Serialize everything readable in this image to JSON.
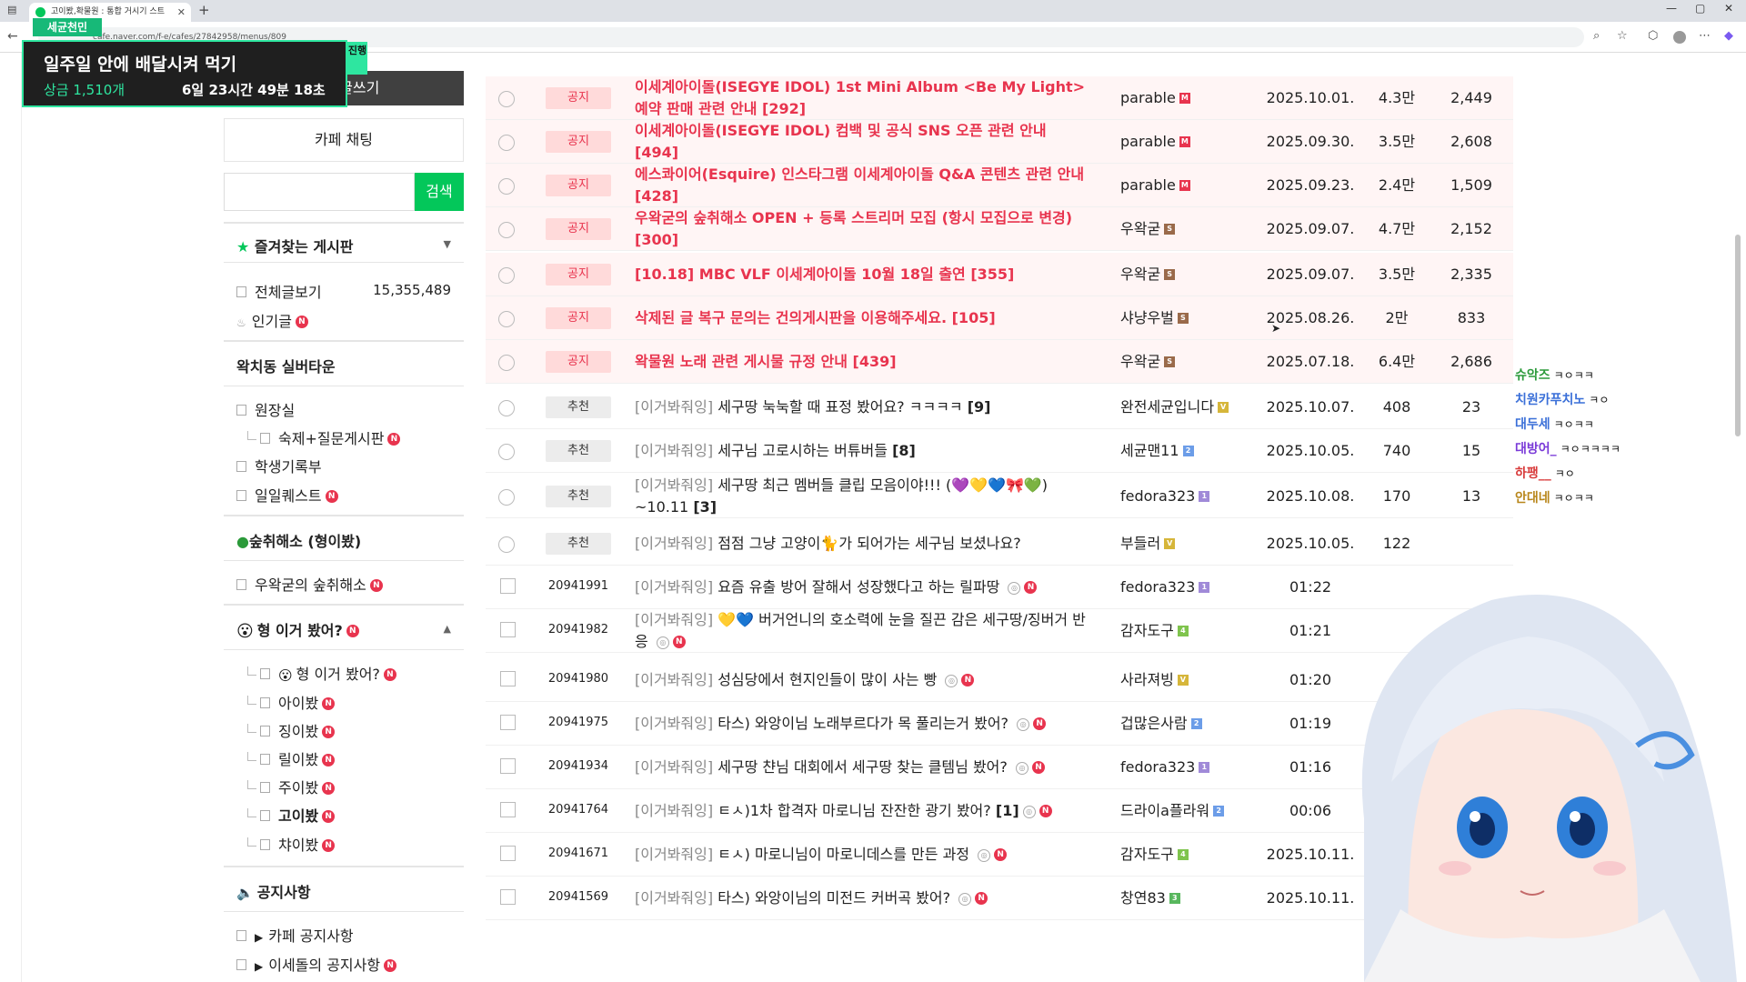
{
  "browser": {
    "tab_title": "고이봤,확물원 : 통합 거시기 스트",
    "url": "cafe.naver.com/f-e/cafes/27842958/menus/809",
    "new_tab": "+",
    "win_min": "—",
    "win_max": "▢",
    "win_close": "✕"
  },
  "overlay": {
    "badge": "세균천민",
    "title": "일주일 안에 배달시켜 먹기",
    "prize": "상금 1,510개",
    "time_left": "6일 23시간 49분 18초",
    "status": "진행"
  },
  "sidebar": {
    "write_label": "카페 글쓰기",
    "chat_label": "카페 채팅",
    "search_placeholder": "",
    "search_button": "검색",
    "favorites": {
      "title": "즐겨찾는 게시판",
      "items": [
        {
          "label": "전체글보기",
          "count": "15,355,489"
        },
        {
          "label": "인기글",
          "new": "N"
        }
      ]
    },
    "town": {
      "title": "왁치동 실버타운",
      "items": [
        {
          "label": "원장실"
        },
        {
          "label": "숙제+질문게시판",
          "new": "N"
        },
        {
          "label": "학생기록부"
        },
        {
          "label": "일일퀘스트",
          "new": "N"
        }
      ]
    },
    "rest": {
      "title": "숲취해소 (형이봤)",
      "items": [
        {
          "label": "우왁굳의 숲취해소",
          "new": "N"
        }
      ]
    },
    "hyung": {
      "title": "형 이거 봤어?",
      "new": "N",
      "items": [
        {
          "label": "형 이거 봤어?",
          "new": "N"
        },
        {
          "label": "아이봤",
          "new": "N"
        },
        {
          "label": "징이봤",
          "new": "N"
        },
        {
          "label": "릴이봤",
          "new": "N"
        },
        {
          "label": "주이봤",
          "new": "N"
        },
        {
          "label": "고이봤",
          "new": "N"
        },
        {
          "label": "챠이봤",
          "new": "N"
        }
      ]
    },
    "notice": {
      "title": "공지사항",
      "items": [
        {
          "label": "카페 공지사항"
        },
        {
          "label": "이세돌의 공지사항",
          "new": "N"
        }
      ]
    }
  },
  "board": {
    "rows": [
      {
        "type": "notice",
        "tag": "공지",
        "title": "이세계아이돌(ISEGYE IDOL) 1st Mini Album <Be My Light> 예약 판매 관련 안내 [292]",
        "author": "parable",
        "lv": "M",
        "date": "2025.10.01.",
        "views": "4.3만",
        "likes": "2,449"
      },
      {
        "type": "notice",
        "tag": "공지",
        "title": "이세계아이돌(ISEGYE IDOL) 컴백 및 공식 SNS 오픈 관련 안내 [494]",
        "author": "parable",
        "lv": "M",
        "date": "2025.09.30.",
        "views": "3.5만",
        "likes": "2,608"
      },
      {
        "type": "notice",
        "tag": "공지",
        "title": "에스콰이어(Esquire) 인스타그램 이세계아이돌 Q&A 콘텐츠 관련 안내 [428]",
        "author": "parable",
        "lv": "M",
        "date": "2025.09.23.",
        "views": "2.4만",
        "likes": "1,509"
      },
      {
        "type": "notice",
        "tag": "공지",
        "title": "우왁굳의 숲취해소 OPEN + 등록 스트리머 모집 (항시 모집으로 변경) [300]",
        "author": "우왁굳",
        "lv": "S",
        "date": "2025.09.07.",
        "views": "4.7만",
        "likes": "2,152"
      },
      {
        "type": "notice",
        "tag": "공지",
        "title": "[10.18] MBC VLF 이세계아이돌 10월 18일 출연 [355]",
        "author": "우왁굳",
        "lv": "S",
        "date": "2025.09.07.",
        "views": "3.5만",
        "likes": "2,335"
      },
      {
        "type": "notice",
        "tag": "공지",
        "title": "삭제된 글 복구 문의는 건의게시판을 이용해주세요. [105]",
        "author": "샤냥우벌",
        "lv": "S",
        "date": "2025.08.26.",
        "views": "2만",
        "likes": "833"
      },
      {
        "type": "notice",
        "tag": "공지",
        "title": "왁물원 노래 관련 게시물 규정 안내 [439]",
        "author": "우왁굳",
        "lv": "S",
        "date": "2025.07.18.",
        "views": "6.4만",
        "likes": "2,686"
      },
      {
        "type": "pin",
        "tag": "추천",
        "cat": "[이거봐줘잉]",
        "title": "세구땅 눅눅할 때 표정 봤어요? ㅋㅋㅋㅋ",
        "cnt": "[9]",
        "author": "완전세균입니다",
        "lv": "V",
        "date": "2025.10.07.",
        "views": "408",
        "likes": "23"
      },
      {
        "type": "pin",
        "tag": "추천",
        "cat": "[이거봐줘잉]",
        "title": "세구님 고로시하는 버튜버들",
        "cnt": "[8]",
        "author": "세균맨11",
        "lv": "2",
        "date": "2025.10.05.",
        "views": "740",
        "likes": "15"
      },
      {
        "type": "pin",
        "tag": "추천",
        "cat": "[이거봐줘잉]",
        "title": "세구땅 최근 멤버들 클립 모음이야!!! (💜💛💙🎀💚) ~10.11",
        "cnt": "[3]",
        "author": "fedora323",
        "lv": "1",
        "date": "2025.10.08.",
        "views": "170",
        "likes": "13"
      },
      {
        "type": "pin",
        "tag": "추천",
        "cat": "[이거봐줘잉]",
        "title": "점점 그냥 고양이🐈가 되어가는 세구님 보셨나요?",
        "cnt": "",
        "author": "부들러",
        "lv": "V",
        "date": "2025.10.05.",
        "views": "122",
        "likes": ""
      },
      {
        "type": "post",
        "num": "20941991",
        "cat": "[이거봐줘잉]",
        "title": "요즘 유출 방어 잘해서 성장했다고 하는 릴파땅",
        "cnt": "",
        "author": "fedora323",
        "lv": "1",
        "date": "01:22",
        "views": "",
        "likes": ""
      },
      {
        "type": "post",
        "num": "20941982",
        "cat": "[이거봐줘잉]",
        "title": "💛💙 버거언니의 호소력에 눈을 질끈 감은 세구땅/징버거 반응",
        "cnt": "",
        "author": "감자도구",
        "lv": "4",
        "date": "01:21",
        "views": "",
        "likes": ""
      },
      {
        "type": "post",
        "num": "20941980",
        "cat": "[이거봐줘잉]",
        "title": "성심당에서 현지인들이 많이 사는 빵",
        "cnt": "",
        "author": "사라져빙",
        "lv": "V",
        "date": "01:20",
        "views": "",
        "likes": ""
      },
      {
        "type": "post",
        "num": "20941975",
        "cat": "[이거봐줘잉]",
        "title": "타스) 와앙이님 노래부르다가 목 풀리는거 봤어?",
        "cnt": "",
        "author": "겁많은사람",
        "lv": "2",
        "date": "01:19",
        "views": "",
        "likes": ""
      },
      {
        "type": "post",
        "num": "20941934",
        "cat": "[이거봐줘잉]",
        "title": "세구땅 챤님 대회에서 세구땅 찾는 클템님 봤어?",
        "cnt": "",
        "author": "fedora323",
        "lv": "1",
        "date": "01:16",
        "views": "",
        "likes": ""
      },
      {
        "type": "post",
        "num": "20941764",
        "cat": "[이거봐줘잉]",
        "title": "ㅌㅅ)1차 합격자 마로니님 잔잔한 광기 봤어?",
        "cnt": "[1]",
        "author": "드라이a플라워",
        "lv": "2",
        "date": "00:06",
        "views": "",
        "likes": ""
      },
      {
        "type": "post",
        "num": "20941671",
        "cat": "[이거봐줘잉]",
        "title": "ㅌㅅ) 마로니님이 마로니데스를 만든 과정",
        "cnt": "",
        "author": "감자도구",
        "lv": "4",
        "date": "2025.10.11.",
        "views": "1",
        "likes": ""
      },
      {
        "type": "post",
        "num": "20941569",
        "cat": "[이거봐줘잉]",
        "title": "타스) 와앙이님의 미전드 커버곡 봤어?",
        "cnt": "",
        "author": "창연83",
        "lv": "3",
        "date": "2025.10.11.",
        "views": "6",
        "likes": "2"
      }
    ]
  },
  "chat": {
    "lines": [
      {
        "name": "슈악즈",
        "msg": "ㅋㅇㅋㅋ",
        "color": "#2b9a3a"
      },
      {
        "name": "치원카푸치노",
        "msg": "ㅋㅇ",
        "color": "#3a6fd8"
      },
      {
        "name": "대두세",
        "msg": "ㅋㅇㅋㅋ",
        "color": "#3a6fd8"
      },
      {
        "name": "대방어_",
        "msg": "ㅋㅇㅋㅋㅋㅋ",
        "color": "#7a3ad8"
      },
      {
        "name": "하팽__",
        "msg": "ㅋㅇ",
        "color": "#d83a3a"
      },
      {
        "name": "안대네",
        "msg": "ㅋㅇㅋㅋ",
        "color": "#b8861a"
      }
    ]
  }
}
